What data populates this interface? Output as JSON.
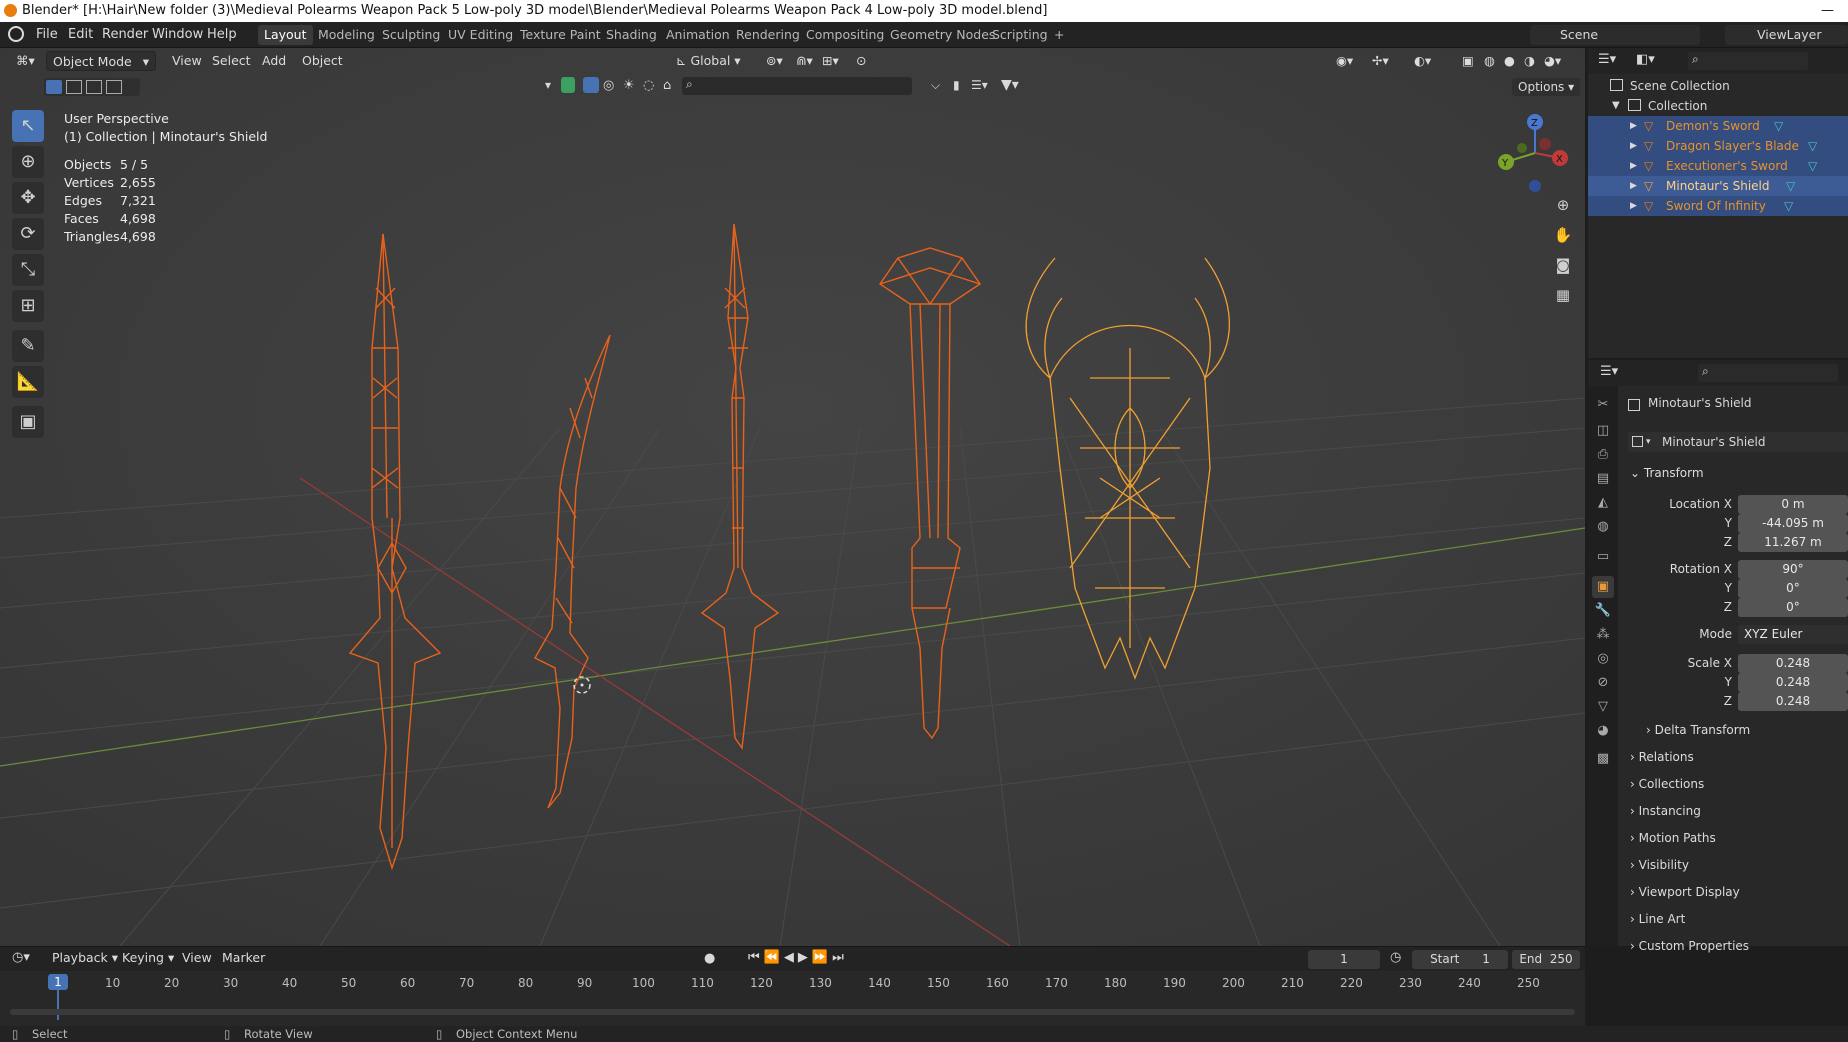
{
  "title_bar": {
    "title": "Blender* [H:\\Hair\\New folder (3)\\Medieval Polearms Weapon Pack 5 Low-poly 3D model\\Blender\\Medieval Polearms Weapon Pack 4 Low-poly 3D model.blend]"
  },
  "top_menu": [
    "File",
    "Edit",
    "Render",
    "Window",
    "Help"
  ],
  "workspaces": [
    "Layout",
    "Modeling",
    "Sculpting",
    "UV Editing",
    "Texture Paint",
    "Shading",
    "Animation",
    "Rendering",
    "Compositing",
    "Geometry Nodes",
    "Scripting"
  ],
  "workspace_add": "+",
  "scene": {
    "name": "Scene",
    "view_layer": "ViewLayer"
  },
  "viewport_header": {
    "mode": "Object Mode",
    "menus": [
      "View",
      "Select",
      "Add",
      "Object"
    ],
    "orientation": "Global",
    "options": "Options"
  },
  "overlay": {
    "perspective": "User Perspective",
    "context": "(1) Collection | Minotaur's Shield",
    "stats": [
      {
        "label": "Objects",
        "value": "5 / 5"
      },
      {
        "label": "Vertices",
        "value": "2,655"
      },
      {
        "label": "Edges",
        "value": "7,321"
      },
      {
        "label": "Faces",
        "value": "4,698"
      },
      {
        "label": "Triangles",
        "value": "4,698"
      }
    ]
  },
  "gizmo": {
    "x": "X",
    "y": "Y",
    "z": "Z"
  },
  "outliner": {
    "scene_collection": "Scene Collection",
    "collection": "Collection",
    "items": [
      {
        "name": "Demon's Sword",
        "active": false
      },
      {
        "name": "Dragon Slayer's Blade",
        "active": false
      },
      {
        "name": "Executioner's Sword",
        "active": false
      },
      {
        "name": "Minotaur's Shield",
        "active": true
      },
      {
        "name": "Sword Of Infinity",
        "active": false
      }
    ]
  },
  "properties": {
    "object_name": "Minotaur's Shield",
    "object_field": "Minotaur's Shield",
    "transform_label": "Transform",
    "location": {
      "label": "Location X",
      "x": "0 m",
      "y": "-44.095 m",
      "z": "11.267 m"
    },
    "rotation": {
      "label": "Rotation X",
      "x": "90°",
      "y": "0°",
      "z": "0°"
    },
    "mode": {
      "label": "Mode",
      "value": "XYZ Euler"
    },
    "scale": {
      "label": "Scale X",
      "x": "0.248",
      "y": "0.248",
      "z": "0.248"
    },
    "axis_labels": {
      "y": "Y",
      "z": "Z"
    },
    "sections": [
      "Delta Transform",
      "Relations",
      "Collections",
      "Instancing",
      "Motion Paths",
      "Visibility",
      "Viewport Display",
      "Line Art",
      "Custom Properties"
    ]
  },
  "timeline": {
    "menus": [
      "Playback",
      "Keying",
      "View",
      "Marker"
    ],
    "current_frame": "1",
    "start_label": "Start",
    "start": "1",
    "end_label": "End",
    "end": "250",
    "frames": [
      "10",
      "20",
      "30",
      "40",
      "50",
      "60",
      "70",
      "80",
      "90",
      "100",
      "110",
      "120",
      "130",
      "140",
      "150",
      "160",
      "170",
      "180",
      "190",
      "200",
      "210",
      "220",
      "230",
      "240",
      "250"
    ]
  },
  "statusbar": {
    "select": "Select",
    "rotate": "Rotate View",
    "context": "Object Context Menu"
  },
  "colors": {
    "accent": "#4772b3",
    "selected_wire": "#e87d0d",
    "active_wire": "#f0a030",
    "outliner_sel": "#334d80"
  }
}
